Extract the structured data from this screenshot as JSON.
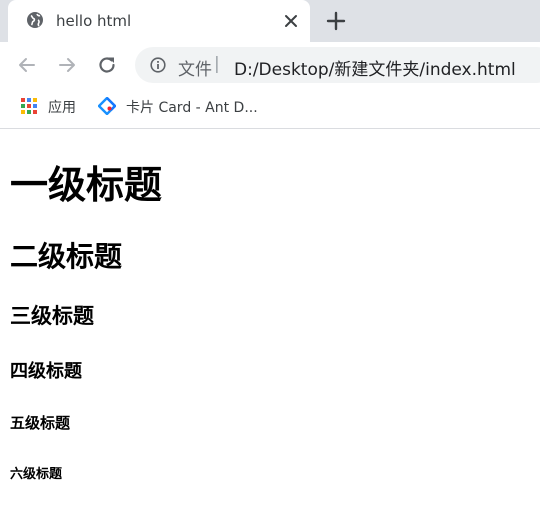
{
  "tab": {
    "title": "hello html",
    "favicon": "globe-icon",
    "close_icon": "close-icon"
  },
  "new_tab_icon": "plus-icon",
  "toolbar": {
    "back_icon": "arrow-left-icon",
    "forward_icon": "arrow-right-icon",
    "reload_icon": "reload-icon"
  },
  "omnibox": {
    "info_icon": "info-icon",
    "prefix": "文件",
    "separator": "|",
    "url": "D:/Desktop/新建文件夹/index.html"
  },
  "bookmarks": [
    {
      "label": "应用",
      "icon": "apps-grid-icon"
    },
    {
      "label": "卡片 Card - Ant D...",
      "icon": "ant-design-icon"
    }
  ],
  "page": {
    "h1": "一级标题",
    "h2": "二级标题",
    "h3": "三级标题",
    "h4": "四级标题",
    "h5": "五级标题",
    "h6": "六级标题"
  },
  "colors": {
    "tabstrip": "#dee1e6",
    "omnibox": "#f1f3f4",
    "text_muted": "#5f6368",
    "ant_blue": "#1890ff",
    "ant_red": "#f5222d"
  }
}
